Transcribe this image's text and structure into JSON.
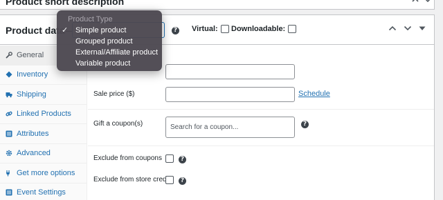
{
  "top_box": {
    "title": "Product short description"
  },
  "header": {
    "title": "Product data",
    "separator": "—",
    "virtual_label": "Virtual:",
    "downloadable_label": "Downloadable:"
  },
  "dropdown": {
    "header": "Product Type",
    "check_mark": "✓",
    "selected": "Simple product",
    "options": [
      "Simple product",
      "Grouped product",
      "External/Affiliate product",
      "Variable product"
    ]
  },
  "tabs": [
    {
      "label": "General",
      "icon": "wrench-icon",
      "active": true
    },
    {
      "label": "Inventory",
      "icon": "diamond-icon",
      "active": false
    },
    {
      "label": "Shipping",
      "icon": "truck-icon",
      "active": false
    },
    {
      "label": "Linked Products",
      "icon": "link-icon",
      "active": false
    },
    {
      "label": "Attributes",
      "icon": "list-icon",
      "active": false
    },
    {
      "label": "Advanced",
      "icon": "gear-icon",
      "active": false
    },
    {
      "label": "Get more options",
      "icon": "plug-icon",
      "active": false
    },
    {
      "label": "Event Settings",
      "icon": "list-icon",
      "active": false
    }
  ],
  "general": {
    "regular_price": {
      "value": ""
    },
    "sale_price": {
      "label": "Sale price ($)",
      "value": ""
    },
    "schedule_link": "Schedule",
    "gift_coupon": {
      "label": "Gift a coupon(s)",
      "placeholder": "Search for a coupon..."
    },
    "exclude_coupons": {
      "label": "Exclude from coupons"
    },
    "exclude_store_credit": {
      "label": "Exclude from store credit"
    }
  },
  "help_icon_glyph": "?",
  "colors": {
    "link": "#2271b1",
    "text": "#1d2327",
    "dropdown_bg": "#4c4850",
    "focus_border": "#2271b1"
  }
}
